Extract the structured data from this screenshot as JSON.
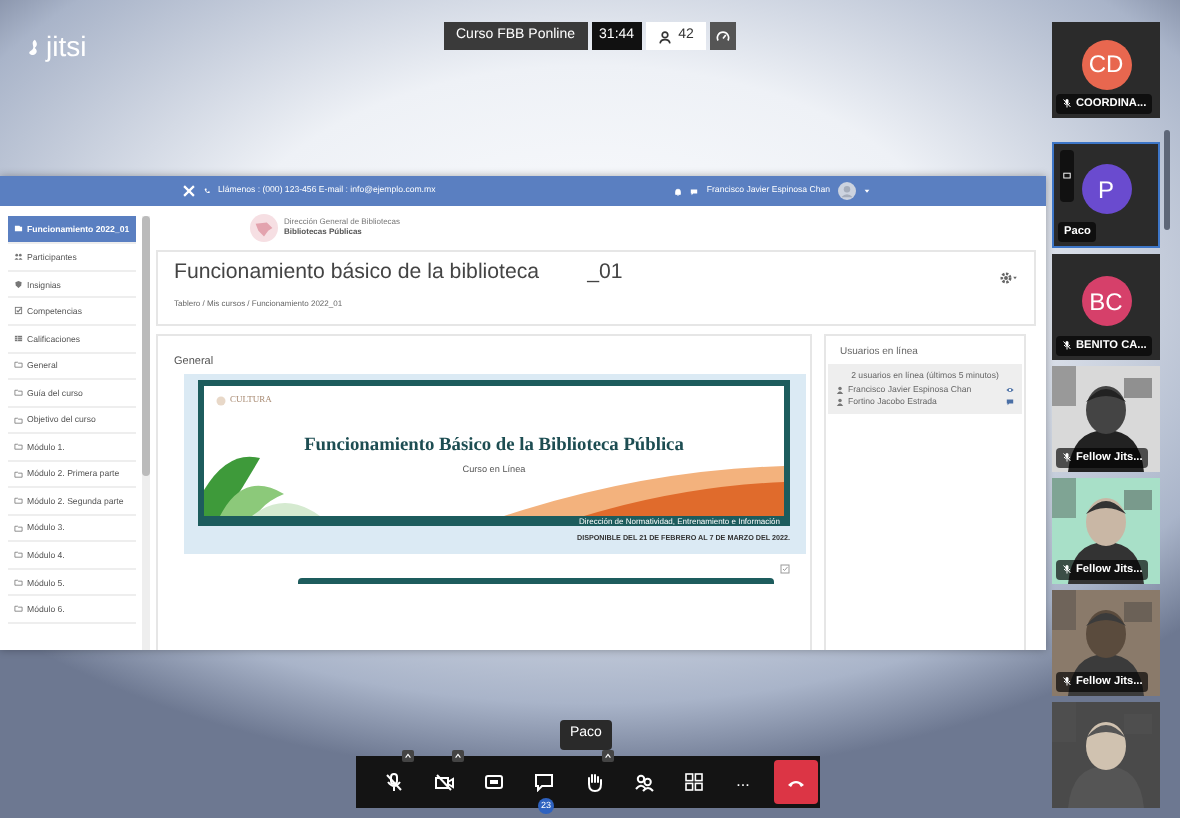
{
  "logo": "jitsi",
  "meeting_bar": {
    "subject": "Curso FBB Ponline",
    "timer": "31:44",
    "participant_count": "42"
  },
  "shared_screen": {
    "navbar": {
      "contact": "Llámenos : (000) 123-456  E-mail : info@ejemplo.com.mx",
      "user": "Francisco Javier Espinosa Chan"
    },
    "drawer": [
      {
        "kind": "course",
        "label": "Funcionamiento 2022_01",
        "selected": true
      },
      {
        "kind": "participants",
        "label": "Participantes",
        "selected": false
      },
      {
        "kind": "badges",
        "label": "Insignias",
        "selected": false
      },
      {
        "kind": "competencies",
        "label": "Competencias",
        "selected": false
      },
      {
        "kind": "grades",
        "label": "Calificaciones",
        "selected": false
      },
      {
        "kind": "section",
        "label": "General",
        "selected": false
      },
      {
        "kind": "section",
        "label": "Guía del curso",
        "selected": false
      },
      {
        "kind": "section",
        "label": "Objetivo del curso",
        "selected": false
      },
      {
        "kind": "section",
        "label": "Módulo 1.",
        "selected": false
      },
      {
        "kind": "section",
        "label": "Módulo 2. Primera parte",
        "selected": false
      },
      {
        "kind": "section",
        "label": "Módulo 2. Segunda parte",
        "selected": false
      },
      {
        "kind": "section",
        "label": "Módulo 3.",
        "selected": false
      },
      {
        "kind": "section",
        "label": "Módulo 4.",
        "selected": false
      },
      {
        "kind": "section",
        "label": "Módulo 5.",
        "selected": false
      },
      {
        "kind": "section",
        "label": "Módulo 6.",
        "selected": false
      }
    ],
    "site_logo": {
      "line_1": "Dirección General de Bibliotecas",
      "line_2": "Bibliotecas Públicas"
    },
    "header": {
      "title": "Funcionamiento básico de la biblioteca",
      "suffix": "_01",
      "breadcrumb": "Tablero  /  Mis cursos  /  Funcionamiento 2022_01"
    },
    "section": {
      "title": "General",
      "banner": {
        "brand": "CULTURA",
        "title": "Funcionamiento Básico de la Biblioteca Pública",
        "subtitle": "Curso en Línea",
        "footer": "Dirección de Normatividad, Entrenamiento e Información"
      },
      "availability": "DISPONIBLE DEL 21 DE FEBRERO AL 7 DE MARZO DEL 2022."
    },
    "online_block": {
      "title": "Usuarios en línea",
      "summary": "2 usuarios en línea (últimos 5 minutos)",
      "users": [
        {
          "name": "Francisco Javier Espinosa Chan",
          "kind": "view"
        },
        {
          "name": "Fortino Jacobo Estrada",
          "kind": "message"
        }
      ]
    }
  },
  "filmstrip": [
    {
      "kind": "avatar",
      "initials": "CD",
      "color": "#e8674f",
      "name": "COORDINA...",
      "muted": true,
      "selected": false,
      "sharing": false
    },
    {
      "kind": "avatar",
      "initials": "P",
      "color": "#6a4bcf",
      "name": "Paco",
      "muted": false,
      "selected": true,
      "sharing": true
    },
    {
      "kind": "avatar",
      "initials": "BC",
      "color": "#d6406a",
      "name": "BENITO CA...",
      "muted": true,
      "selected": false,
      "sharing": false
    },
    {
      "kind": "video",
      "name": "Fellow Jits...",
      "muted": true,
      "selected": false,
      "sharing": false
    },
    {
      "kind": "video",
      "name": "Fellow Jits...",
      "muted": true,
      "selected": false,
      "sharing": false
    },
    {
      "kind": "video",
      "name": "Fellow Jits...",
      "muted": true,
      "selected": false,
      "sharing": false
    },
    {
      "kind": "video",
      "muted": false,
      "selected": false,
      "sharing": false
    }
  ],
  "tooltip": "Paco",
  "toolbar": [
    {
      "kind": "microphone",
      "muted": true,
      "menu": true
    },
    {
      "kind": "camera",
      "muted": true,
      "menu": true
    },
    {
      "kind": "share",
      "menu": false
    },
    {
      "kind": "chat",
      "menu": false,
      "badge": "23"
    },
    {
      "kind": "raise_hand",
      "menu": true
    },
    {
      "kind": "participants",
      "menu": false
    },
    {
      "kind": "tile_view",
      "menu": false
    },
    {
      "kind": "more",
      "menu": false,
      "label": "..."
    },
    {
      "kind": "hangup",
      "menu": false
    }
  ]
}
